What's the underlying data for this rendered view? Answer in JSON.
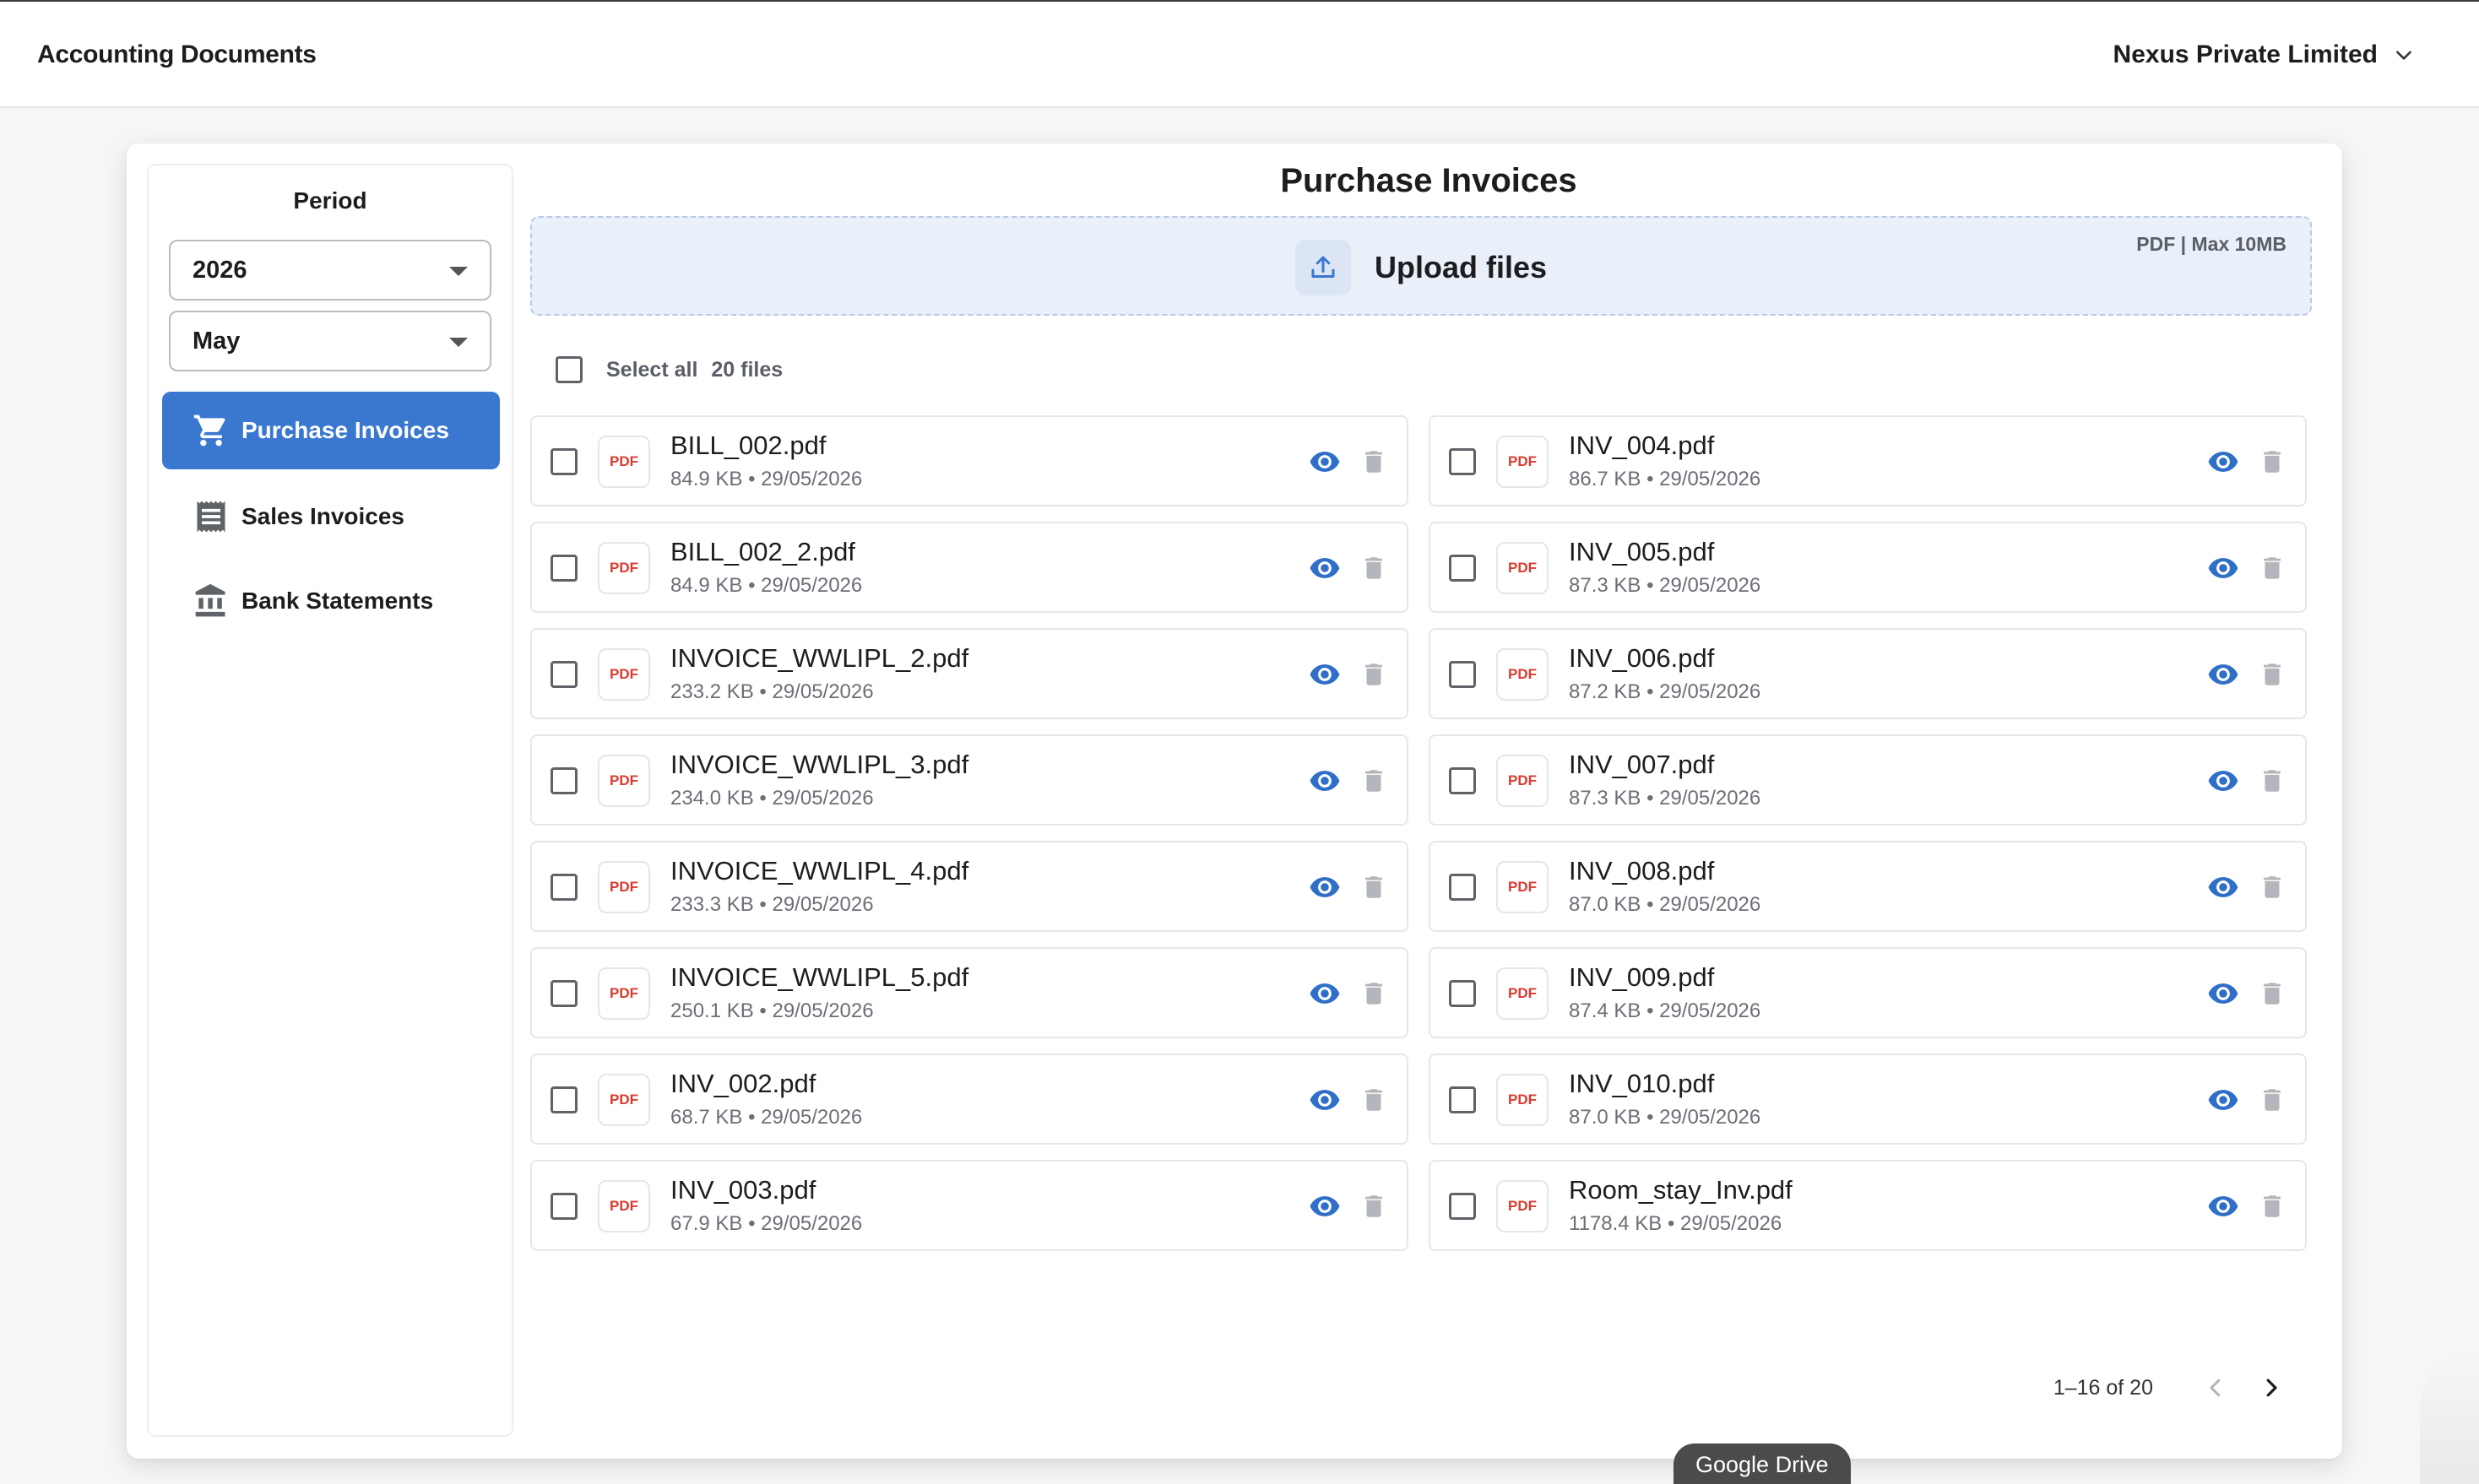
{
  "header": {
    "title": "Accounting Documents",
    "company": "Nexus Private Limited"
  },
  "sidebar": {
    "period_label": "Period",
    "year": "2026",
    "month": "May",
    "items": [
      {
        "label": "Purchase Invoices",
        "icon": "cart-icon",
        "active": true
      },
      {
        "label": "Sales Invoices",
        "icon": "receipt-icon",
        "active": false
      },
      {
        "label": "Bank Statements",
        "icon": "bank-icon",
        "active": false
      }
    ]
  },
  "main": {
    "title": "Purchase Invoices",
    "upload": {
      "label": "Upload files",
      "note": "PDF | Max 10MB"
    },
    "select_all": {
      "label": "Select all",
      "count": "20 files"
    },
    "badge_text": "PDF",
    "files": [
      {
        "name": "BILL_002.pdf",
        "meta": "84.9 KB • 29/05/2026"
      },
      {
        "name": "INV_004.pdf",
        "meta": "86.7 KB • 29/05/2026"
      },
      {
        "name": "BILL_002_2.pdf",
        "meta": "84.9 KB • 29/05/2026"
      },
      {
        "name": "INV_005.pdf",
        "meta": "87.3 KB • 29/05/2026"
      },
      {
        "name": "INVOICE_WWLIPL_2.pdf",
        "meta": "233.2 KB • 29/05/2026"
      },
      {
        "name": "INV_006.pdf",
        "meta": "87.2 KB • 29/05/2026"
      },
      {
        "name": "INVOICE_WWLIPL_3.pdf",
        "meta": "234.0 KB • 29/05/2026"
      },
      {
        "name": "INV_007.pdf",
        "meta": "87.3 KB • 29/05/2026"
      },
      {
        "name": "INVOICE_WWLIPL_4.pdf",
        "meta": "233.3 KB • 29/05/2026"
      },
      {
        "name": "INV_008.pdf",
        "meta": "87.0 KB • 29/05/2026"
      },
      {
        "name": "INVOICE_WWLIPL_5.pdf",
        "meta": "250.1 KB • 29/05/2026"
      },
      {
        "name": "INV_009.pdf",
        "meta": "87.4 KB • 29/05/2026"
      },
      {
        "name": "INV_002.pdf",
        "meta": "68.7 KB • 29/05/2026"
      },
      {
        "name": "INV_010.pdf",
        "meta": "87.0 KB • 29/05/2026"
      },
      {
        "name": "INV_003.pdf",
        "meta": "67.9 KB • 29/05/2026"
      },
      {
        "name": "Room_stay_Inv.pdf",
        "meta": "1178.4 KB • 29/05/2026"
      }
    ],
    "pagination": {
      "range": "1–16 of 20"
    }
  },
  "tooltip": {
    "text": "Google Drive"
  },
  "colors": {
    "accent": "#3a78d0",
    "view_icon": "#2f6fc8",
    "delete_icon": "#b3b6bb",
    "pdf_text": "#d93b30",
    "upload_bg": "#eaf0f9"
  }
}
